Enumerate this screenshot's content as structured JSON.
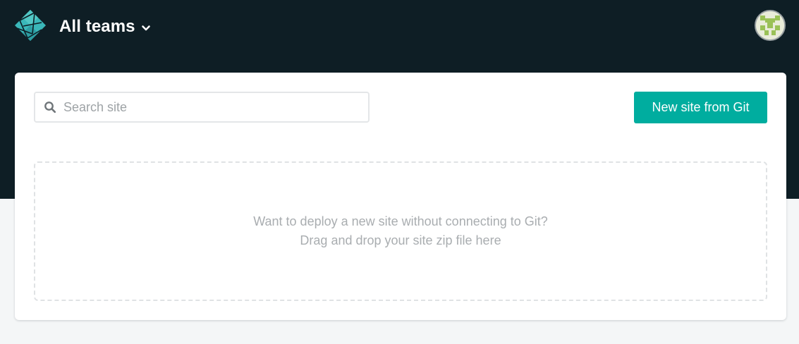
{
  "header": {
    "logo_icon": "netlify-logo-icon",
    "team_switcher_label": "All teams",
    "team_switcher_icon": "chevron-down-icon",
    "avatar_icon": "user-avatar-icon",
    "background_color": "#0e1e25"
  },
  "sites": {
    "search": {
      "icon": "search-icon",
      "placeholder": "Search site",
      "value": ""
    },
    "new_site_button_label": "New site from Git",
    "dropzone": {
      "line1": "Want to deploy a new site without connecting to Git?",
      "line2": "Drag and drop your site zip file here"
    }
  },
  "colors": {
    "accent": "#00ad9f",
    "page_background": "#f4f6f7",
    "card_background": "#ffffff"
  }
}
